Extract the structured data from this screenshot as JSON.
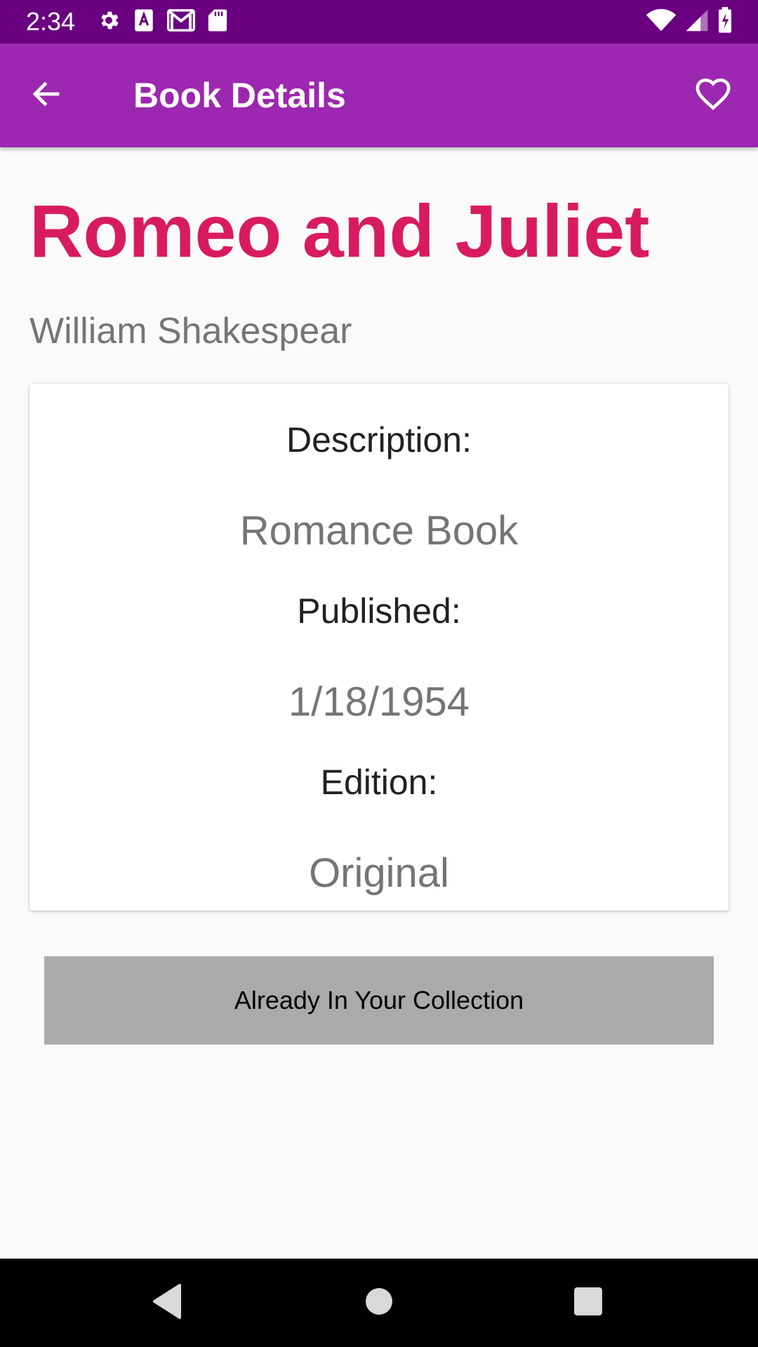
{
  "status_bar": {
    "time": "2:34",
    "left_icons": [
      "settings-icon",
      "font-icon",
      "gmail-icon",
      "sd-card-icon"
    ],
    "right_icons": [
      "wifi-icon",
      "signal-icon",
      "battery-charging-icon"
    ]
  },
  "app_bar": {
    "title": "Book Details",
    "back_icon": "arrow-back-icon",
    "favorite_icon": "heart-outline-icon",
    "color": "#9c27b0"
  },
  "book": {
    "title": "Romeo and Juliet",
    "author": "William Shakespear",
    "title_color": "#d81b60"
  },
  "details": {
    "description_label": "Description:",
    "description_value": "Romance Book",
    "published_label": "Published:",
    "published_value": "1/18/1954",
    "edition_label": "Edition:",
    "edition_value": "Original"
  },
  "collection_button": {
    "label": "Already In Your Collection"
  },
  "nav_bar": {
    "icons": [
      "back-triangle-icon",
      "home-circle-icon",
      "recents-square-icon"
    ]
  }
}
